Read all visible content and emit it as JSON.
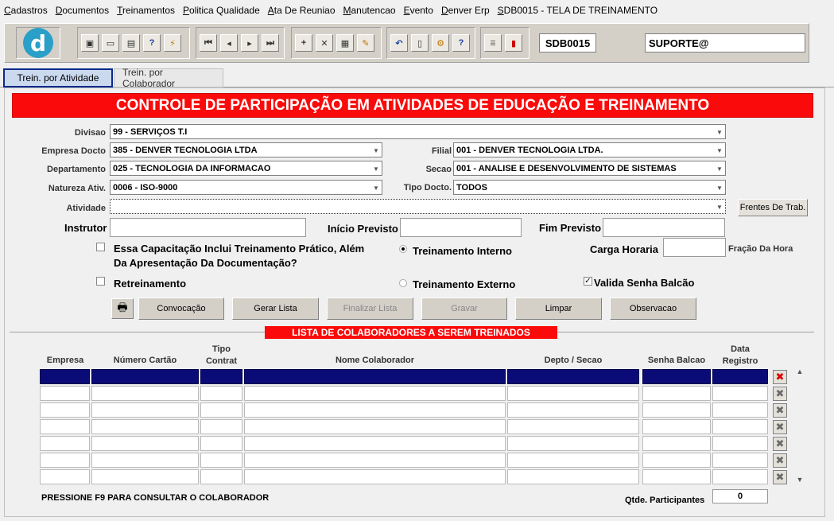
{
  "menu": [
    "Cadastros",
    "Documentos",
    "Treinamentos",
    "Politica Qualidade",
    "Ata De Reuniao",
    "Manutencao",
    "Evento",
    "Denver Erp",
    "SDB0015 - TELA DE TREINAMENTO"
  ],
  "toolbar": {
    "logo_letter": "d",
    "form_code": "SDB0015",
    "user": "SUPORTE@"
  },
  "tabs": {
    "active": "Trein. por Atividade",
    "inactive": "Trein. por Colaborador"
  },
  "title": "CONTROLE DE PARTICIPAÇÃO EM ATIVIDADES DE EDUCAÇÃO E TREINAMENTO",
  "form": {
    "divisao_label": "Divisao",
    "divisao_value": "99 - SERVIÇOS T.I",
    "empresa_label": "Empresa Docto",
    "empresa_value": "385 - DENVER TECNOLOGIA LTDA",
    "filial_label": "Filial",
    "filial_value": "001 - DENVER TECNOLOGIA LTDA.",
    "departamento_label": "Departamento",
    "departamento_value": "025 - TECNOLOGIA DA INFORMACAO",
    "secao_label": "Secao",
    "secao_value": "001 - ANALISE E DESENVOLVIMENTO DE SISTEMAS",
    "natureza_label": "Natureza Ativ.",
    "natureza_value": "0006 - ISO-9000",
    "tipo_docto_label": "Tipo Docto.",
    "tipo_docto_value": "TODOS",
    "atividade_label": "Atividade",
    "atividade_value": "",
    "frentes_button": "Frentes De Trab.",
    "instrutor_label": "Instrutor",
    "inicio_label": "Início Previsto",
    "fim_label": "Fim Previsto",
    "capacitacao_label_1": "Essa Capacitação Inclui Treinamento Prático, Além",
    "capacitacao_label_2": "Da Apresentação Da Documentação?",
    "retreinamento_label": "Retreinamento",
    "treinamento_interno_label": "Treinamento Interno",
    "treinamento_externo_label": "Treinamento Externo",
    "carga_label": "Carga Horaria",
    "fracao_label": "Fração Da Hora",
    "valida_senha_label": "Valida Senha Balcão"
  },
  "buttons": {
    "convocacao": "Convocação",
    "gerar_lista": "Gerar Lista",
    "finalizar_lista": "Finalizar Lista",
    "gravar": "Gravar",
    "limpar": "Limpar",
    "observacao": "Observacao"
  },
  "list": {
    "banner": "LISTA DE COLABORADORES A SEREM TREINADOS",
    "columns": {
      "empresa": "Empresa",
      "numero_cartao": "Número Cartão",
      "tipo_contrat_1": "Tipo",
      "tipo_contrat_2": "Contrat",
      "nome": "Nome Colaborador",
      "depto": "Depto / Secao",
      "senha": "Senha Balcao",
      "data_1": "Data",
      "data_2": "Registro"
    },
    "rows": 7
  },
  "footer": {
    "hint": "PRESSIONE F9 PARA CONSULTAR O COLABORADOR",
    "qtde_label": "Qtde. Participantes",
    "qtde_value": "0"
  }
}
